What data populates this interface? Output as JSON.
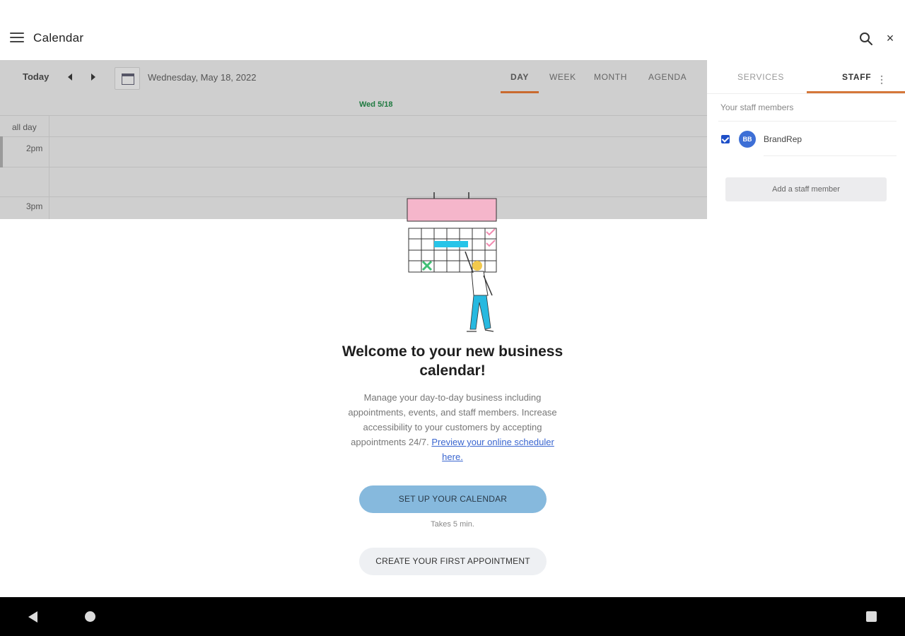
{
  "appbar": {
    "title": "Calendar",
    "menu_icon": "hamburger-menu-icon",
    "search_icon": "search-icon",
    "close_icon": "close-icon",
    "close_glyph": "×"
  },
  "calendar": {
    "today_label": "Today",
    "date_label": "Wednesday, May 18, 2022",
    "views": [
      "DAY",
      "WEEK",
      "MONTH",
      "AGENDA"
    ],
    "active_view": "DAY",
    "day_header": "Wed 5/18",
    "allday_label": "all day",
    "times": [
      "2pm",
      "3pm"
    ]
  },
  "side_panel": {
    "tabs": [
      "SERVICES",
      "STAFF"
    ],
    "active_tab": "STAFF",
    "caption": "Your staff members",
    "staff": [
      {
        "initials": "BB",
        "name": "BrandRep",
        "checked": true
      }
    ],
    "add_button": "Add a staff member"
  },
  "welcome": {
    "title": "Welcome to your new business calendar!",
    "body": "Manage your day-to-day business including appointments, events, and staff members. Increase accessibility to your customers by accepting appointments 24/7.",
    "link_text": "Preview your online scheduler here.",
    "setup_button": "SET UP YOUR CALENDAR",
    "setup_note": "Takes 5 min.",
    "create_button": "CREATE YOUR FIRST APPOINTMENT"
  },
  "colors": {
    "accent_orange": "#d5773a",
    "primary_blue": "#86b9dd",
    "checkbox_blue": "#1e4fc8",
    "day_header_green": "#1f7a40",
    "overlay_gray": "#cfcfcf"
  }
}
